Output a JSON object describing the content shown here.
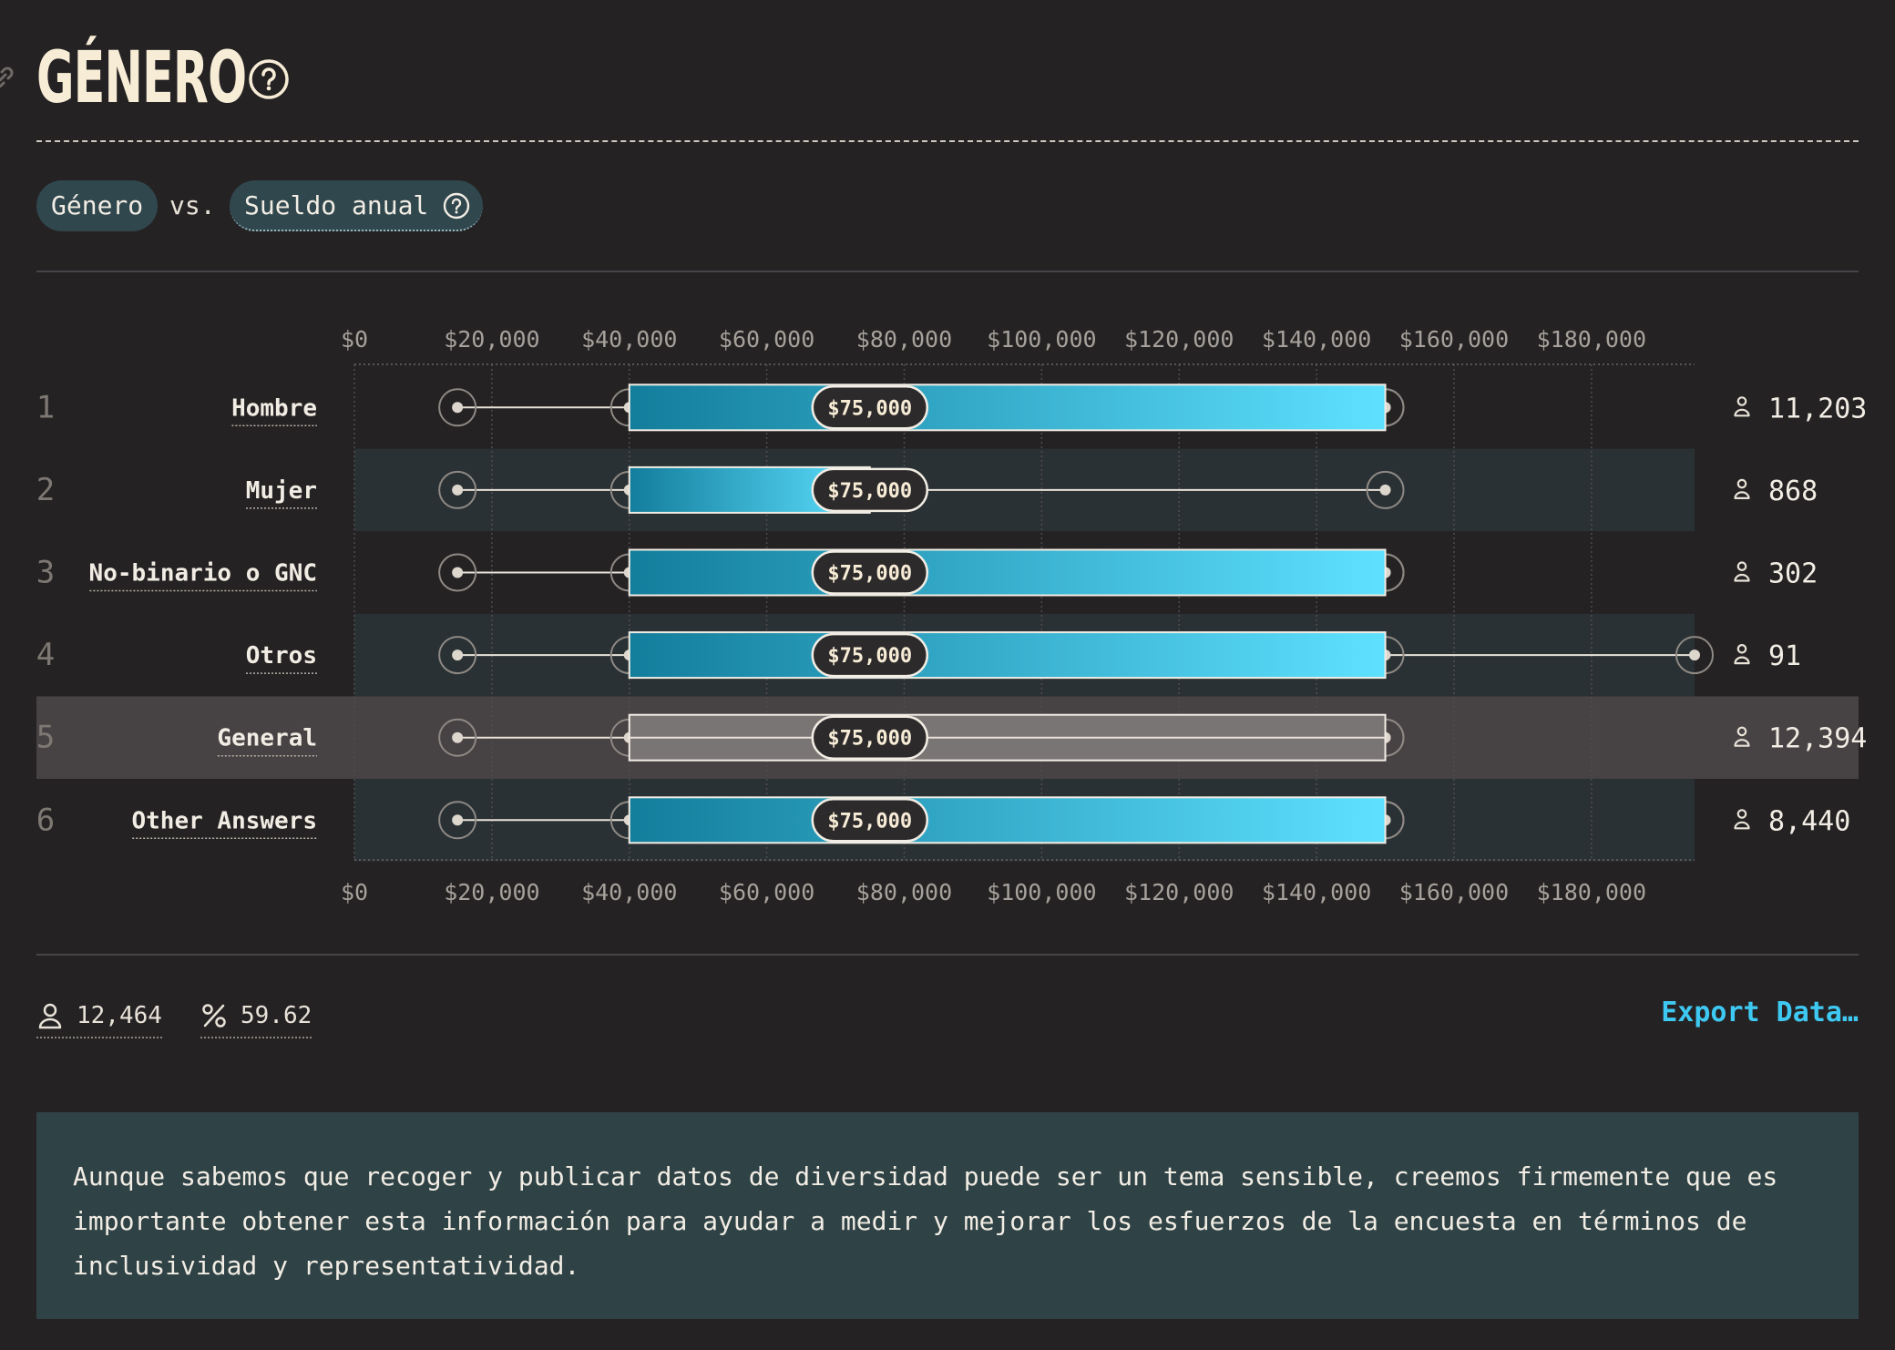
{
  "header": {
    "title": "GÉNERO"
  },
  "controls": {
    "chip_a": "Género",
    "vs": "vs.",
    "chip_b": "Sueldo anual"
  },
  "colors": {
    "bar_start": "#137d9c",
    "bar_end": "#5ee1ff",
    "general_bar": "#7a7575",
    "row_alt_bg": "#2a3134",
    "general_row_bg": "#474243",
    "accent": "#3ec9f2"
  },
  "chart_data": {
    "type": "box",
    "x_axis": {
      "min": 0,
      "max": 195000,
      "ticks": [
        0,
        20000,
        40000,
        60000,
        80000,
        100000,
        120000,
        140000,
        160000,
        180000
      ],
      "tick_labels": [
        "$0",
        "$20,000",
        "$40,000",
        "$60,000",
        "$80,000",
        "$100,000",
        "$120,000",
        "$140,000",
        "$160,000",
        "$180,000"
      ],
      "grid": true
    },
    "rows": [
      {
        "rank": "1",
        "label": "Hombre",
        "whisker_low": 15000,
        "q1": 40000,
        "median": 75000,
        "q3": 150000,
        "whisker_high": 150000,
        "median_label": "$75,000",
        "count": "11,203"
      },
      {
        "rank": "2",
        "label": "Mujer",
        "whisker_low": 15000,
        "q1": 40000,
        "median": 75000,
        "q3": 75000,
        "whisker_high": 150000,
        "median_label": "$75,000",
        "count": "868"
      },
      {
        "rank": "3",
        "label": "No-binario o GNC",
        "whisker_low": 15000,
        "q1": 40000,
        "median": 75000,
        "q3": 150000,
        "whisker_high": 150000,
        "median_label": "$75,000",
        "count": "302"
      },
      {
        "rank": "4",
        "label": "Otros",
        "whisker_low": 15000,
        "q1": 40000,
        "median": 75000,
        "q3": 150000,
        "whisker_high": 195000,
        "median_label": "$75,000",
        "count": "91"
      },
      {
        "rank": "5",
        "label": "General",
        "whisker_low": 15000,
        "q1": 40000,
        "median": 75000,
        "q3": 150000,
        "whisker_high": 150000,
        "median_label": "$75,000",
        "count": "12,394",
        "highlight": true
      },
      {
        "rank": "6",
        "label": "Other Answers",
        "whisker_low": 15000,
        "q1": 40000,
        "median": 75000,
        "q3": 150000,
        "whisker_high": 150000,
        "median_label": "$75,000",
        "count": "8,440"
      }
    ]
  },
  "footer": {
    "respondents": "12,464",
    "percent": "59.62",
    "export_label": "Export Data…"
  },
  "note": {
    "text": "Aunque sabemos que recoger y publicar datos de diversidad puede ser un tema sensible, creemos firmemente que es importante obtener esta información para ayudar a medir y mejorar los esfuerzos de la encuesta en términos de inclusividad y representatividad."
  }
}
